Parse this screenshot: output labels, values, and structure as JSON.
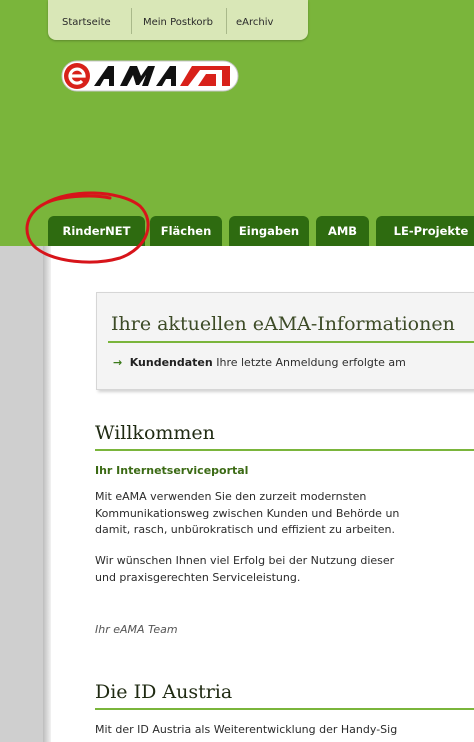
{
  "topnav": {
    "items": [
      "Startseite",
      "Mein Postkorb",
      "eArchiv"
    ]
  },
  "logo": {
    "text": "eAMA",
    "colors": {
      "red": "#d8211a",
      "black": "#111111"
    }
  },
  "tabs": [
    "RinderNET",
    "Flächen",
    "Eingaben",
    "AMB",
    "LE-Projekte"
  ],
  "info": {
    "title": "Ihre aktuellen eAMA-Informationen",
    "item_label": "Kundendaten",
    "item_text": "Ihre letzte Anmeldung erfolgte am"
  },
  "welcome": {
    "heading": "Willkommen",
    "subheading": "Ihr Internetserviceportal",
    "lines": [
      "Mit eAMA verwenden Sie den zurzeit modernsten",
      "Kommunikationsweg zwischen Kunden und Behörde un",
      "damit, rasch, unbürokratisch und effizient zu arbeiten."
    ],
    "lines2": [
      "Wir wünschen Ihnen viel Erfolg bei der Nutzung dieser",
      "und praxisgerechten Serviceleistung."
    ],
    "signature": "Ihr eAMA Team"
  },
  "idaustria": {
    "heading": "Die ID Austria",
    "text": "Mit der ID Austria als Weiterentwicklung der Handy-Sig"
  },
  "colors": {
    "header_green": "#7ab53b",
    "tab_green": "#2e6b10",
    "annotation_red": "#d7141a"
  }
}
